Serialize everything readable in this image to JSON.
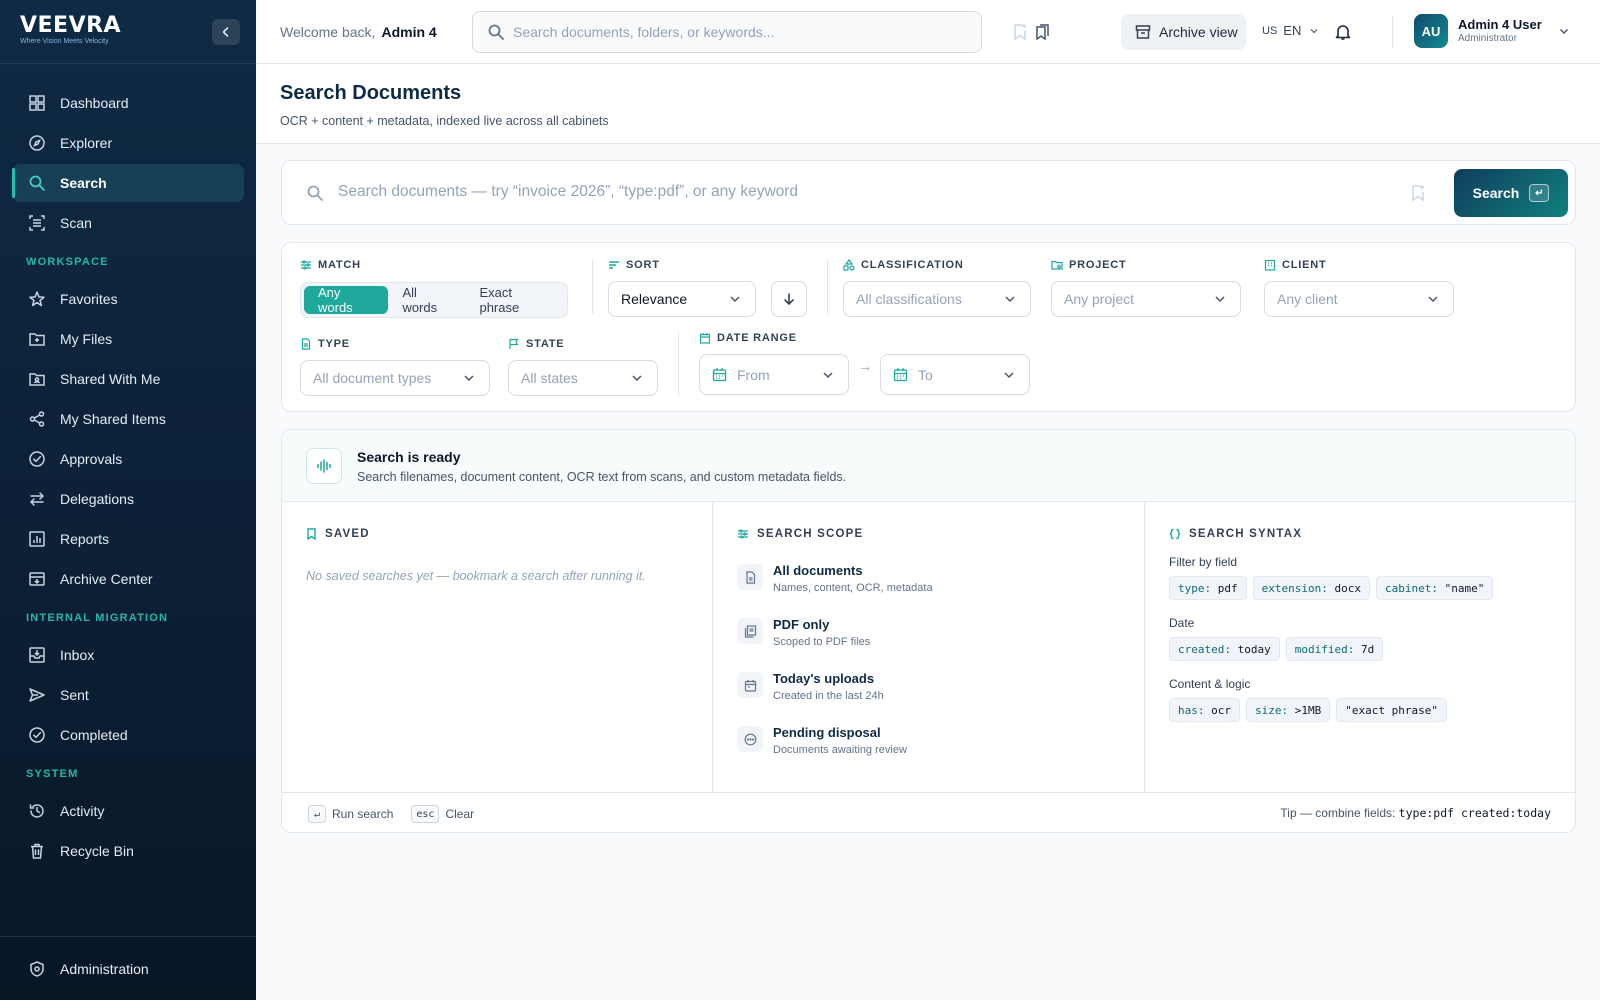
{
  "brand": {
    "name": "VEEVRA",
    "tagline": "Where Vision Meets Velocity"
  },
  "sidebar": {
    "main_items": [
      {
        "label": "Dashboard",
        "icon": "dashboard-icon"
      },
      {
        "label": "Explorer",
        "icon": "compass-icon"
      },
      {
        "label": "Search",
        "icon": "search-icon",
        "active": true
      },
      {
        "label": "Scan",
        "icon": "scan-icon"
      }
    ],
    "sections": [
      {
        "title": "WORKSPACE",
        "items": [
          {
            "label": "Favorites",
            "icon": "star-icon"
          },
          {
            "label": "My Files",
            "icon": "folder-icon"
          },
          {
            "label": "Shared With Me",
            "icon": "shared-folder-icon"
          },
          {
            "label": "My Shared Items",
            "icon": "share-icon"
          },
          {
            "label": "Approvals",
            "icon": "check-circle-icon"
          },
          {
            "label": "Delegations",
            "icon": "swap-icon"
          },
          {
            "label": "Reports",
            "icon": "report-icon"
          },
          {
            "label": "Archive Center",
            "icon": "archive-icon"
          }
        ]
      },
      {
        "title": "INTERNAL MIGRATION",
        "items": [
          {
            "label": "Inbox",
            "icon": "inbox-icon"
          },
          {
            "label": "Sent",
            "icon": "send-icon"
          },
          {
            "label": "Completed",
            "icon": "check-circle-icon"
          }
        ]
      },
      {
        "title": "SYSTEM",
        "items": [
          {
            "label": "Activity",
            "icon": "history-icon"
          },
          {
            "label": "Recycle Bin",
            "icon": "trash-icon"
          }
        ]
      }
    ],
    "bottom_item": {
      "label": "Administration",
      "icon": "admin-shield-icon"
    }
  },
  "topbar": {
    "welcome_prefix": "Welcome back,",
    "welcome_user": "Admin 4",
    "search_placeholder": "Search documents, folders, or keywords...",
    "archive_label": "Archive view",
    "lang_flag": "US",
    "lang_code": "EN",
    "user": {
      "initials": "AU",
      "name": "Admin 4 User",
      "role": "Administrator"
    }
  },
  "page": {
    "title": "Search Documents",
    "subtitle": "OCR + content + metadata, indexed live across all cabinets"
  },
  "search": {
    "placeholder": "Search documents — try “invoice 2026”, “type:pdf”, or any keyword",
    "button_label": "Search",
    "button_kbd": "↵"
  },
  "filters": {
    "match": {
      "label": "MATCH",
      "options": [
        "Any words",
        "All words",
        "Exact phrase"
      ],
      "selected": "Any words"
    },
    "sort": {
      "label": "SORT",
      "value": "Relevance"
    },
    "classification": {
      "label": "CLASSIFICATION",
      "placeholder": "All classifications"
    },
    "project": {
      "label": "PROJECT",
      "placeholder": "Any project"
    },
    "client": {
      "label": "CLIENT",
      "placeholder": "Any client"
    },
    "type": {
      "label": "TYPE",
      "placeholder": "All document types"
    },
    "state": {
      "label": "STATE",
      "placeholder": "All states"
    },
    "date_range": {
      "label": "DATE RANGE",
      "from": "From",
      "to": "To",
      "separator": "→"
    }
  },
  "ready": {
    "title": "Search is ready",
    "description": "Search filenames, document content, OCR text from scans, and custom metadata fields."
  },
  "saved": {
    "heading": "SAVED",
    "empty": "No saved searches yet — bookmark a search after running it."
  },
  "scope": {
    "heading": "SEARCH SCOPE",
    "items": [
      {
        "title": "All documents",
        "desc": "Names, content, OCR, metadata",
        "icon": "document-icon"
      },
      {
        "title": "PDF only",
        "desc": "Scoped to PDF files",
        "icon": "pdf-stack-icon"
      },
      {
        "title": "Today's uploads",
        "desc": "Created in the last 24h",
        "icon": "calendar-icon"
      },
      {
        "title": "Pending disposal",
        "desc": "Documents awaiting review",
        "icon": "more-circle-icon"
      }
    ]
  },
  "syntax": {
    "heading": "SEARCH SYNTAX",
    "groups": [
      {
        "label": "Filter by field",
        "chips": [
          {
            "key": "type:",
            "val": " pdf"
          },
          {
            "key": "extension:",
            "val": " docx"
          },
          {
            "key": "cabinet:",
            "val": " \"name\""
          }
        ]
      },
      {
        "label": "Date",
        "chips": [
          {
            "key": "created:",
            "val": " today"
          },
          {
            "key": "modified:",
            "val": " 7d"
          }
        ]
      },
      {
        "label": "Content & logic",
        "chips": [
          {
            "key": "has:",
            "val": " ocr"
          },
          {
            "key": "size:",
            "val": " >1MB"
          },
          {
            "key": "",
            "val": "\"exact phrase\""
          }
        ]
      }
    ]
  },
  "footer": {
    "run_kbd": "↵",
    "run_label": "Run search",
    "clear_kbd": "esc",
    "clear_label": "Clear",
    "tip_prefix": "Tip — combine fields:",
    "tip_code": "type:pdf created:today"
  },
  "colors": {
    "accent": "#1fa99d",
    "sidebar_bg": "#0c2036",
    "brand_dark": "#0f2a44"
  }
}
